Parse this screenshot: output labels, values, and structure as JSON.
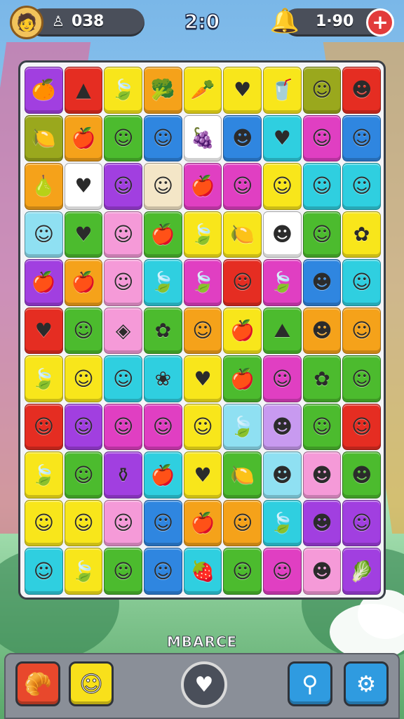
{
  "hud": {
    "score": "0З8",
    "timer": "2:0",
    "coins": "1·90",
    "plus_label": "+"
  },
  "brand": "MBARCE",
  "colors": {
    "red": "#e52d22",
    "orange": "#f5a21a",
    "yellow": "#f8e61b",
    "lime": "#9bd52a",
    "green": "#4cbb2e",
    "teal": "#2fcfe0",
    "blue": "#2f86e0",
    "purple": "#a13fe0",
    "magenta": "#e03fc2",
    "pink": "#f59ad8",
    "olive": "#9aa81d",
    "cream": "#f4e6c7",
    "white": "#ffffff",
    "lightblue": "#8fe0f2",
    "lavender": "#c89af0"
  },
  "board": [
    [
      [
        "purple",
        "fruit-icon"
      ],
      [
        "red",
        "triangle-icon"
      ],
      [
        "yellow",
        "leaf-icon"
      ],
      [
        "orange",
        "broccoli-icon"
      ],
      [
        "yellow",
        "carrot-icon"
      ],
      [
        "yellow",
        "heart-icon"
      ],
      [
        "yellow",
        "cup-icon"
      ],
      [
        "olive",
        "face-icon"
      ],
      [
        "red",
        "hat-face-icon"
      ]
    ],
    [
      [
        "olive",
        "lemon-icon"
      ],
      [
        "orange",
        "apple-icon"
      ],
      [
        "green",
        "face-icon"
      ],
      [
        "blue",
        "face-icon"
      ],
      [
        "white",
        "plum-icon"
      ],
      [
        "blue",
        "hat-face-icon"
      ],
      [
        "teal",
        "heart-icon"
      ],
      [
        "magenta",
        "face-icon"
      ],
      [
        "blue",
        "face-icon"
      ]
    ],
    [
      [
        "orange",
        "pear-icon"
      ],
      [
        "white",
        "heart-icon"
      ],
      [
        "purple",
        "face-icon"
      ],
      [
        "cream",
        "face-icon"
      ],
      [
        "magenta",
        "apple-icon"
      ],
      [
        "magenta",
        "face-icon"
      ],
      [
        "yellow",
        "fruit-face-icon"
      ],
      [
        "teal",
        "face-icon"
      ],
      [
        "teal",
        "face-icon"
      ]
    ],
    [
      [
        "lightblue",
        "fruit-face-icon"
      ],
      [
        "green",
        "heart-icon"
      ],
      [
        "pink",
        "fruit-face-icon"
      ],
      [
        "green",
        "apple-icon"
      ],
      [
        "yellow",
        "leaf-icon"
      ],
      [
        "yellow",
        "lemon-icon"
      ],
      [
        "white",
        "hat-face-icon"
      ],
      [
        "green",
        "face-icon"
      ],
      [
        "yellow",
        "creature-icon"
      ]
    ],
    [
      [
        "purple",
        "apple-icon"
      ],
      [
        "orange",
        "apple-icon"
      ],
      [
        "pink",
        "face-icon"
      ],
      [
        "teal",
        "leaf-icon"
      ],
      [
        "magenta",
        "leaf-icon"
      ],
      [
        "red",
        "fruit-face-icon"
      ],
      [
        "magenta",
        "leaf-icon"
      ],
      [
        "blue",
        "hat-face-icon"
      ],
      [
        "teal",
        "fruit-face-icon"
      ]
    ],
    [
      [
        "red",
        "heart-icon"
      ],
      [
        "green",
        "fruit-face-icon"
      ],
      [
        "pink",
        "bowl-icon"
      ],
      [
        "green",
        "creature-icon"
      ],
      [
        "orange",
        "fruit-face-icon"
      ],
      [
        "yellow",
        "apple-icon"
      ],
      [
        "green",
        "cake-icon"
      ],
      [
        "orange",
        "hat-face-icon"
      ],
      [
        "orange",
        "face-icon"
      ]
    ],
    [
      [
        "yellow",
        "leaf-icon"
      ],
      [
        "yellow",
        "fruit-face-icon"
      ],
      [
        "teal",
        "fruit-face-icon"
      ],
      [
        "teal",
        "flower-icon"
      ],
      [
        "yellow",
        "heart-icon"
      ],
      [
        "green",
        "apple-icon"
      ],
      [
        "magenta",
        "face-icon"
      ],
      [
        "green",
        "creature-icon"
      ],
      [
        "green",
        "fruit-face-icon"
      ]
    ],
    [
      [
        "red",
        "fruit-face-icon"
      ],
      [
        "purple",
        "fruit-face-icon"
      ],
      [
        "magenta",
        "face-icon"
      ],
      [
        "magenta",
        "fruit-face-icon"
      ],
      [
        "yellow",
        "face-icon"
      ],
      [
        "lightblue",
        "leaf-icon"
      ],
      [
        "lavender",
        "hat-face-icon"
      ],
      [
        "green",
        "face-icon"
      ],
      [
        "red",
        "fruit-face-icon"
      ]
    ],
    [
      [
        "yellow",
        "leaf-icon"
      ],
      [
        "green",
        "face-icon"
      ],
      [
        "purple",
        "jar-icon"
      ],
      [
        "teal",
        "apple-icon"
      ],
      [
        "yellow",
        "heart-icon"
      ],
      [
        "green",
        "lemon-icon"
      ],
      [
        "lightblue",
        "hat-face-icon"
      ],
      [
        "pink",
        "hat-face-icon"
      ],
      [
        "green",
        "hat-face-icon"
      ]
    ],
    [
      [
        "yellow",
        "fruit-face-icon"
      ],
      [
        "yellow",
        "face-icon"
      ],
      [
        "pink",
        "fruit-face-icon"
      ],
      [
        "blue",
        "fruit-face-icon"
      ],
      [
        "orange",
        "apple-icon"
      ],
      [
        "orange",
        "face-icon"
      ],
      [
        "teal",
        "leaf-icon"
      ],
      [
        "purple",
        "hat-face-icon"
      ],
      [
        "purple",
        "fruit-face-icon"
      ]
    ],
    [
      [
        "teal",
        "fruit-face-icon"
      ],
      [
        "yellow",
        "leaf-icon"
      ],
      [
        "green",
        "face-icon"
      ],
      [
        "blue",
        "face-icon"
      ],
      [
        "teal",
        "berry-icon"
      ],
      [
        "green",
        "fruit-face-icon"
      ],
      [
        "magenta",
        "face-icon"
      ],
      [
        "pink",
        "hat-face-icon"
      ],
      [
        "purple",
        "veggie-icon"
      ]
    ]
  ],
  "icons": {
    "fruit-icon": "🍊",
    "triangle-icon": "▲",
    "leaf-icon": "🍃",
    "broccoli-icon": "🥦",
    "carrot-icon": "🥕",
    "heart-icon": "♥",
    "cup-icon": "🥤",
    "face-icon": "☺",
    "hat-face-icon": "☻",
    "lemon-icon": "🍋",
    "apple-icon": "🍎",
    "plum-icon": "🍇",
    "pear-icon": "🍐",
    "fruit-face-icon": "☺",
    "creature-icon": "✿",
    "bowl-icon": "◈",
    "cake-icon": "⛰",
    "flower-icon": "❀",
    "jar-icon": "⚱",
    "berry-icon": "🍓",
    "veggie-icon": "🥬"
  },
  "bottom_buttons": {
    "left1": "🥐",
    "left2": "☺",
    "center": "♥",
    "right1": "⚲",
    "right2": "⚙"
  }
}
